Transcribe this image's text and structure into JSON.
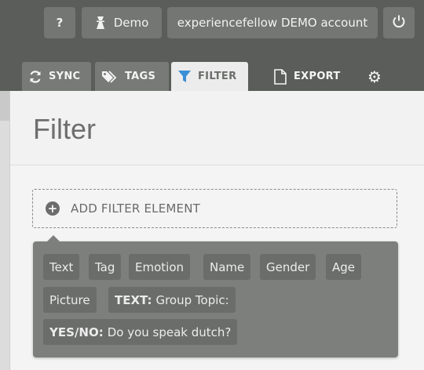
{
  "topbar": {
    "help_label": "?",
    "user_label": "Demo",
    "account_label": "experiencefellow DEMO account",
    "power_icon": "power-icon"
  },
  "tabs": [
    {
      "label": "SYNC",
      "icon": "sync-icon"
    },
    {
      "label": "TAGS",
      "icon": "tag-icon"
    },
    {
      "label": "FILTER",
      "icon": "filter-icon",
      "active": true
    },
    {
      "label": "EXPORT",
      "icon": "document-icon"
    },
    {
      "label": "",
      "icon": "gear-icon"
    }
  ],
  "panel": {
    "title": "Filter",
    "add_filter_label": "ADD FILTER ELEMENT"
  },
  "filter_options": [
    {
      "label": "Text"
    },
    {
      "label": "Tag"
    },
    {
      "label": "Emotion"
    },
    {
      "label": "Name"
    },
    {
      "label": "Gender"
    },
    {
      "label": "Age"
    },
    {
      "label": "Picture"
    },
    {
      "prefix": "TEXT:",
      "label": "Group Topic:"
    },
    {
      "prefix": "YES/NO:",
      "label": "Do you speak dutch?"
    }
  ],
  "colors": {
    "header_bg": "#5a5d5a",
    "filter_icon": "#3a8fd6",
    "popover_bg": "#7c7f7c",
    "chip_bg": "#6a6d6a"
  }
}
